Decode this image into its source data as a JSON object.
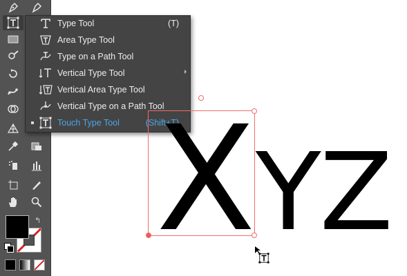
{
  "menu": {
    "items": [
      {
        "label": "Type Tool",
        "shortcut": "(T)",
        "icon": "type-tool-icon"
      },
      {
        "label": "Area Type Tool",
        "shortcut": "",
        "icon": "area-type-tool-icon"
      },
      {
        "label": "Type on a Path Tool",
        "shortcut": "",
        "icon": "type-on-path-tool-icon"
      },
      {
        "label": "Vertical Type Tool",
        "shortcut": "",
        "icon": "vertical-type-tool-icon"
      },
      {
        "label": "Vertical Area Type Tool",
        "shortcut": "",
        "icon": "vertical-area-type-tool-icon"
      },
      {
        "label": "Vertical Type on a Path Tool",
        "shortcut": "",
        "icon": "vertical-type-on-path-tool-icon"
      },
      {
        "label": "Touch Type Tool",
        "shortcut": "(Shift+T)",
        "icon": "touch-type-tool-icon",
        "selected": true
      }
    ]
  },
  "canvas": {
    "first_char": "X",
    "rest_text": "YZ"
  },
  "colors": {
    "toolbar_bg": "#535353",
    "menu_bg": "#444444",
    "selected_text": "#49a6e8",
    "bbox": "#f26b6b",
    "fill": "#000000",
    "stroke": "#ffffff"
  }
}
